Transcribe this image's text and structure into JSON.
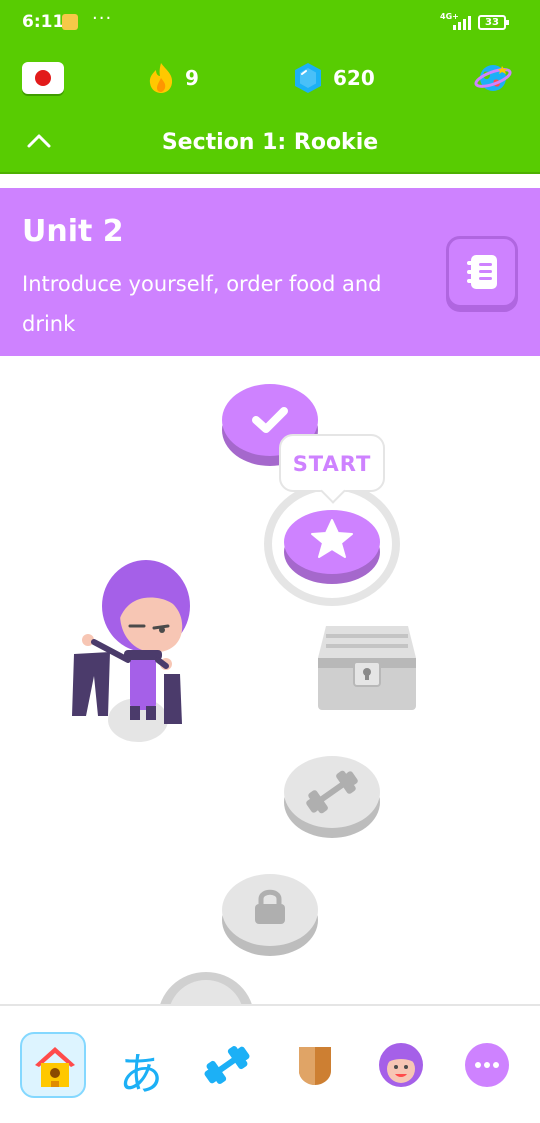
{
  "status_bar": {
    "time": "6:11",
    "dots": "···",
    "network": "4G+",
    "battery": "33"
  },
  "top_bar": {
    "streak_count": "9",
    "gems_count": "620"
  },
  "section": {
    "title": "Section 1: Rookie"
  },
  "unit": {
    "title": "Unit 2",
    "description": "Introduce yourself, order food and drink"
  },
  "path": {
    "start_label": "START",
    "nodes": [
      "completed",
      "current",
      "chest-locked",
      "practice-locked",
      "lesson-locked",
      "lesson-locked"
    ]
  },
  "bottom_nav": {
    "items": [
      "home",
      "characters",
      "practice",
      "leagues",
      "profile",
      "more"
    ],
    "hiragana_glyph": "あ"
  },
  "colors": {
    "duolingo_green": "#58cc02",
    "unit_purple": "#ce82ff",
    "node_purple": "#ce82ff",
    "locked_gray": "#e5e5e5",
    "blue": "#1cb0f6"
  }
}
